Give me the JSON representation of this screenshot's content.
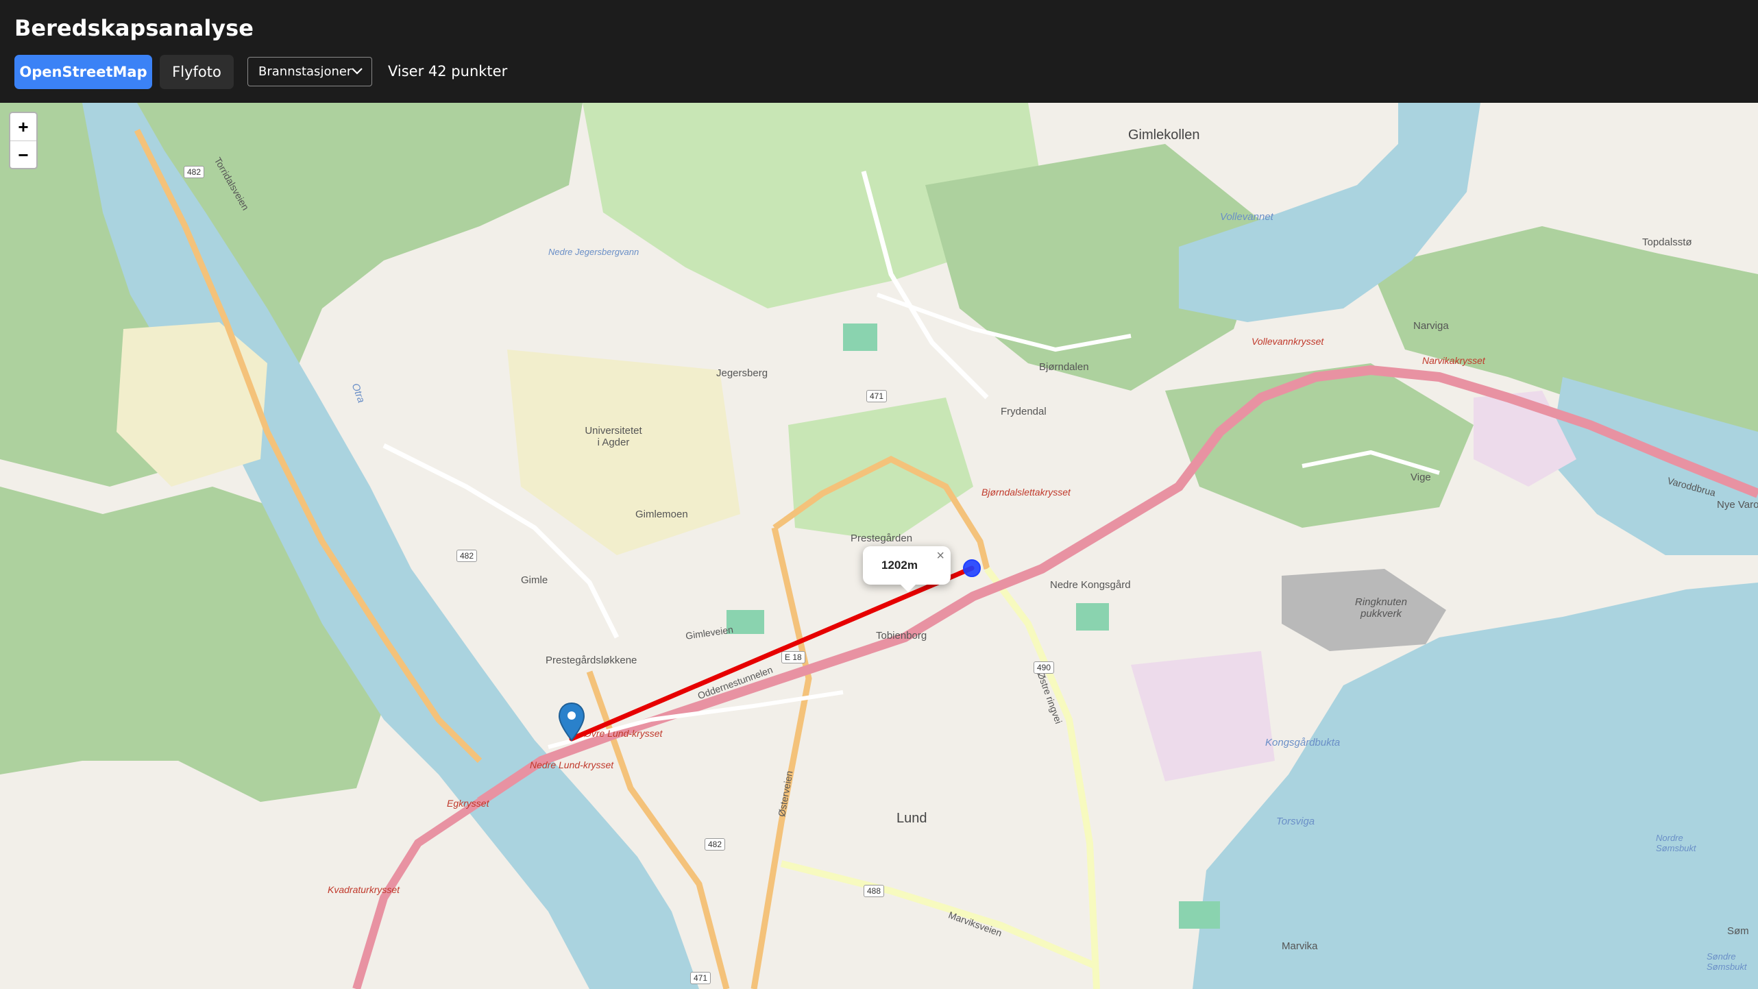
{
  "app": {
    "title": "Beredskapsanalyse"
  },
  "toolbar": {
    "osm_label": "OpenStreetMap",
    "flyfoto_label": "Flyfoto",
    "layer_select_value": "Brannstasjoner",
    "count_text": "Viser 42 punkter"
  },
  "map": {
    "zoom_in": "+",
    "zoom_out": "−",
    "popup_text": "1202m",
    "popup_close": "×",
    "colors": {
      "route": "#e60000",
      "origin_marker": "#1e3fff",
      "pin": "#2a81cb"
    },
    "labels": {
      "gimlekollen": "Gimlekollen",
      "vollevannet": "Vollevannet",
      "topdalsto": "Topdalsstø",
      "narviga": "Narviga",
      "bjorndalen": "Bjørndalen",
      "frydendal": "Frydendal",
      "jegersberg": "Jegersberg",
      "uia": "Universitetet i Agder",
      "gimlemoen": "Gimlemoen",
      "gimle": "Gimle",
      "prestegardsløkkene": "Prestegårdsløkkene",
      "prestegarden": "Prestegården",
      "tobienborg": "Tobienborg",
      "nedre_kongsgard": "Nedre Kongsgård",
      "ringknuten": "Ringknuten pukkverk",
      "vige": "Vige",
      "kongsgardbukta": "Kongsgårdbukta",
      "torsviga": "Torsviga",
      "lund": "Lund",
      "marvika": "Marvika",
      "otra": "Otra",
      "nedre_jegersbergvann": "Nedre Jegersbergvann",
      "vollevannkrysset": "Vollevannkrysset",
      "narvikakrysset": "Narvikakrysset",
      "bjorndalslettakrysset": "Bjørndalslettakrysset",
      "ovre_lund_krysset": "Øvre Lund-krysset",
      "nedre_lund_krysset": "Nedre Lund-krysset",
      "egkrysset": "Egkrysset",
      "kvadraturkrysset": "Kvadraturkrysset",
      "oddernestunnelen": "Oddernestunnelen",
      "torridalsveien": "Torridalsveien",
      "ostre_ringvei": "Østre ringvei",
      "marviksveien": "Marviksveien",
      "gimleveien": "Gimleveien",
      "osterveien": "Østerveien",
      "varoddbrua": "Varoddbrua",
      "nye_varo": "Nye Varo",
      "som": "Søm",
      "sondre_somsbukt": "Søndre Sømsbukt",
      "nordre_somsbukt": "Nordre Sømsbukt"
    },
    "shields": [
      "482",
      "471",
      "490",
      "488",
      "E 18",
      "482",
      "482",
      "471"
    ]
  }
}
